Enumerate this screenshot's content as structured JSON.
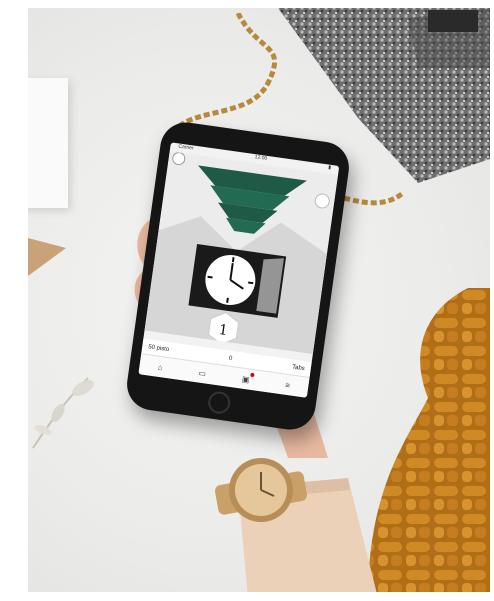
{
  "phone": {
    "status_left": "Carrier",
    "status_center": "12:00",
    "info_left": "50 pisto",
    "info_center": "0",
    "info_right": "Tabs",
    "clock_numeral": "1"
  },
  "tabs": [
    {
      "icon": "home-icon"
    },
    {
      "icon": "card-icon"
    },
    {
      "icon": "wallet-icon"
    },
    {
      "icon": "menu-icon"
    }
  ],
  "colors": {
    "tree_green": "#1e5a46",
    "jacket_mustard": "#c07a1c",
    "watch_gold": "#d4b07a",
    "bag_silver": "#7a7a7a"
  }
}
